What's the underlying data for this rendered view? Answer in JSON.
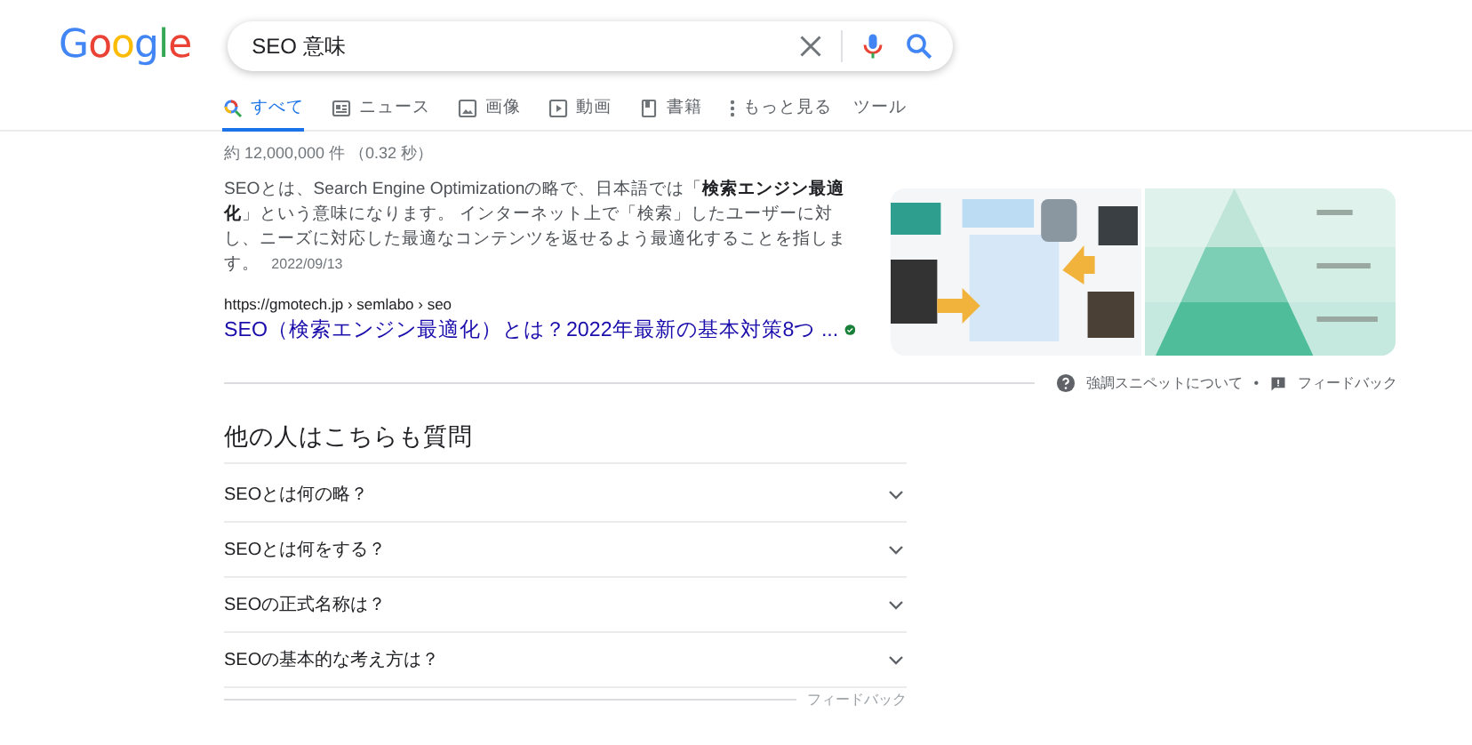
{
  "logo": "Google",
  "search": {
    "value": "SEO 意味"
  },
  "tabs": [
    {
      "label": "すべて",
      "kind": "all",
      "selected": true
    },
    {
      "label": "ニュース",
      "kind": "news",
      "selected": false
    },
    {
      "label": "画像",
      "kind": "images",
      "selected": false
    },
    {
      "label": "動画",
      "kind": "videos",
      "selected": false
    },
    {
      "label": "書籍",
      "kind": "books",
      "selected": false
    },
    {
      "label": "もっと見る",
      "kind": "more",
      "selected": false
    }
  ],
  "tools": "ツール",
  "result_stats": "約 12,000,000 件 （0.32 秒）",
  "featured_snippet": {
    "text": "SEOとは、Search Engine Optimizationの略で、日本語では「**検索エンジン最適化**」という意味になります。 インターネット上で「検索」したユーザーに対し、ニーズに対応した最適なコンテンツを返せるよう最適化することを指します。",
    "date": "2022/09/13",
    "url": "https://gmotech.jp › semlabo › seo",
    "title": "SEO（検索エンジン最適化）とは？2022年最新の基本対策8つ ...",
    "verified": true,
    "about": "強調スニペットについて",
    "separator": "•",
    "feedback": "フィードバック"
  },
  "people_also_ask": {
    "heading": "他の人はこちらも質問",
    "questions": [
      {
        "text": "SEOとは何の略？",
        "expanded": false
      },
      {
        "text": "SEOとは何をする？",
        "expanded": false
      },
      {
        "text": "SEOの正式名称は？",
        "expanded": false
      },
      {
        "text": "SEOの基本的な考え方は？",
        "expanded": false
      }
    ],
    "feedback": "フィードバック"
  }
}
